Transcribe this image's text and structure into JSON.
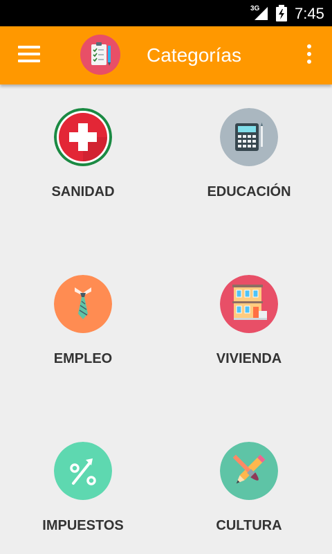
{
  "status_bar": {
    "network": "3G",
    "time": "7:45"
  },
  "app_bar": {
    "title": "Categorías",
    "menu_icon": "hamburger-menu-icon",
    "logo_icon": "clipboard-checklist-icon",
    "overflow_icon": "more-vert-icon",
    "color": "#ff9800"
  },
  "categories": [
    {
      "label": "SANIDAD",
      "icon": "medical-cross-icon",
      "color": "#e32636"
    },
    {
      "label": "EDUCACIÓN",
      "icon": "calculator-icon",
      "color": "#aab7c0"
    },
    {
      "label": "EMPLEO",
      "icon": "necktie-icon",
      "color": "#ff8c52"
    },
    {
      "label": "VIVIENDA",
      "icon": "building-icon",
      "color": "#e84f67"
    },
    {
      "label": "IMPUESTOS",
      "icon": "percent-icon",
      "color": "#5ed8b0"
    },
    {
      "label": "CULTURA",
      "icon": "paintbrush-pencil-icon",
      "color": "#5ec4a6"
    }
  ]
}
